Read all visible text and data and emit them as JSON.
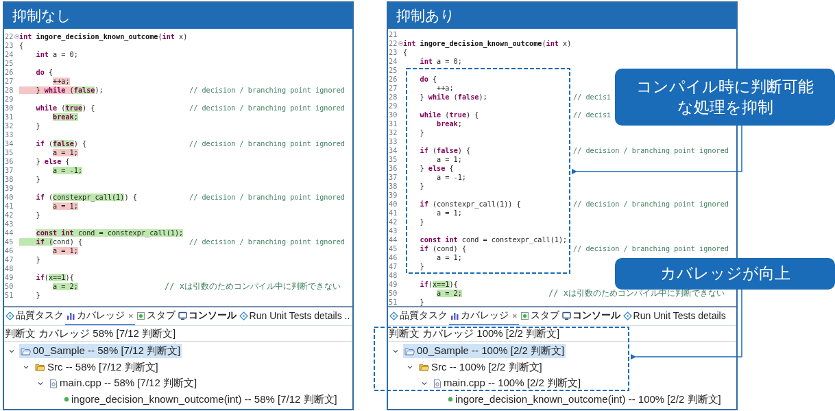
{
  "panels": [
    {
      "title": "抑制なし",
      "editor": {
        "lines": [
          {
            "number": "22",
            "fold": true,
            "code": [
              {
                "text": "int",
                "kind": "keyword"
              },
              {
                "text": " ingore_decision_known_outcome",
                "kind": "name"
              },
              {
                "text": "(",
                "kind": "plain"
              },
              {
                "text": "int",
                "kind": "keyword"
              },
              {
                "text": " x)",
                "kind": "plain"
              }
            ]
          },
          {
            "number": "23",
            "code": [
              {
                "text": "{",
                "kind": "plain"
              }
            ]
          },
          {
            "number": "24",
            "code": [
              {
                "text": "    int",
                "kind": "keyword"
              },
              {
                "text": " a = 0;",
                "kind": "plain"
              }
            ]
          },
          {
            "number": "25"
          },
          {
            "number": "26",
            "code": [
              {
                "text": "    do",
                "kind": "keyword"
              },
              {
                "text": " {",
                "kind": "plain"
              }
            ]
          },
          {
            "number": "27",
            "code": [
              {
                "text": "        ++a;",
                "kind": "plain",
                "color": "#f4c6c6",
                "indent_highlighted": false
              }
            ]
          },
          {
            "number": "28",
            "code": [
              {
                "text": "    } ",
                "kind": "plain",
                "color": "#f4c6c6",
                "indent_highlighted": true
              },
              {
                "text": "while",
                "kind": "keyword",
                "color": "#f4c6c6"
              },
              {
                "text": " (",
                "kind": "plain",
                "color": "#f4c6c6"
              },
              {
                "text": "false",
                "kind": "keyword",
                "color": "#bfe8b0"
              },
              {
                "text": ");",
                "kind": "plain"
              }
            ],
            "comment": "// decision / branching point ignored"
          },
          {
            "number": "29"
          },
          {
            "number": "30",
            "code": [
              {
                "text": "    while",
                "kind": "keyword"
              },
              {
                "text": " (",
                "kind": "plain"
              },
              {
                "text": "true",
                "kind": "keyword",
                "color": "#bfe8b0"
              },
              {
                "text": ") {",
                "kind": "plain"
              }
            ],
            "comment": "// decision / branching point ignored"
          },
          {
            "number": "31",
            "code": [
              {
                "text": "        break",
                "kind": "keyword",
                "color": "#bfe8b0",
                "indent_highlighted": false
              },
              {
                "text": ";",
                "kind": "plain",
                "color": "#bfe8b0"
              }
            ]
          },
          {
            "number": "32",
            "code": [
              {
                "text": "    }",
                "kind": "plain"
              }
            ]
          },
          {
            "number": "33"
          },
          {
            "number": "34",
            "code": [
              {
                "text": "    if",
                "kind": "keyword"
              },
              {
                "text": " (",
                "kind": "plain"
              },
              {
                "text": "false",
                "kind": "keyword",
                "color": "#bfe8b0"
              },
              {
                "text": ") {",
                "kind": "plain"
              }
            ],
            "comment": "// decision / branching point ignored"
          },
          {
            "number": "35",
            "code": [
              {
                "text": "        a = 1;",
                "kind": "plain",
                "color": "#f4c6c6",
                "indent_highlighted": false
              }
            ]
          },
          {
            "number": "36",
            "code": [
              {
                "text": "    } ",
                "kind": "plain"
              },
              {
                "text": "else",
                "kind": "keyword"
              },
              {
                "text": " {",
                "kind": "plain"
              }
            ]
          },
          {
            "number": "37",
            "code": [
              {
                "text": "        a = -1;",
                "kind": "plain",
                "color": "#bfe8b0",
                "indent_highlighted": false
              }
            ]
          },
          {
            "number": "38",
            "code": [
              {
                "text": "    }",
                "kind": "plain"
              }
            ]
          },
          {
            "number": "39"
          },
          {
            "number": "40",
            "code": [
              {
                "text": "    if",
                "kind": "keyword"
              },
              {
                "text": " (",
                "kind": "plain"
              },
              {
                "text": "constexpr_call(1)",
                "kind": "plain",
                "color": "#bfe8b0"
              },
              {
                "text": ") {",
                "kind": "plain"
              }
            ],
            "comment": "// decision / branching point ignored"
          },
          {
            "number": "41",
            "code": [
              {
                "text": "        a = 1;",
                "kind": "plain",
                "color": "#f4c6c6",
                "indent_highlighted": false
              }
            ]
          },
          {
            "number": "42",
            "code": [
              {
                "text": "    }",
                "kind": "plain"
              }
            ]
          },
          {
            "number": "43"
          },
          {
            "number": "44",
            "code": [
              {
                "text": "    const int",
                "kind": "keyword",
                "color": "#bfe8b0",
                "indent_highlighted": false
              },
              {
                "text": " cond = constexpr_call(1);",
                "kind": "plain",
                "color": "#bfe8b0"
              }
            ]
          },
          {
            "number": "45",
            "code": [
              {
                "text": "    if",
                "kind": "keyword",
                "color": "#bfe8b0",
                "indent_highlighted": true
              },
              {
                "text": " (",
                "kind": "plain",
                "color": "#bfe8b0"
              },
              {
                "text": "cond) {",
                "kind": "plain"
              }
            ],
            "comment": "// decision / branching point ignored"
          },
          {
            "number": "46",
            "code": [
              {
                "text": "        a = 1;",
                "kind": "plain",
                "color": "#f4c6c6",
                "indent_highlighted": false
              }
            ]
          },
          {
            "number": "47",
            "code": [
              {
                "text": "    }",
                "kind": "plain"
              }
            ]
          },
          {
            "number": "48"
          },
          {
            "number": "49",
            "code": [
              {
                "text": "    if",
                "kind": "keyword"
              },
              {
                "text": "(",
                "kind": "plain"
              },
              {
                "text": "x==1",
                "kind": "plain",
                "color": "#bfe8b0"
              },
              {
                "text": "){",
                "kind": "plain"
              }
            ]
          },
          {
            "number": "50",
            "code": [
              {
                "text": "        a = 2;",
                "kind": "plain",
                "color": "#bfe8b0",
                "indent_highlighted": false
              }
            ],
            "comment": "// xは引数のためコンパイル中に判断できない"
          },
          {
            "number": "51",
            "code": [
              {
                "text": "    }",
                "kind": "plain"
              }
            ]
          }
        ]
      },
      "coverage_view": {
        "tabs": [
          {
            "label": "品質タスク",
            "kind": "task",
            "selected": false,
            "emphasized": false
          },
          {
            "label": "カバレッジ",
            "kind": "coverage",
            "selected": true,
            "emphasized": false,
            "close": "×"
          },
          {
            "label": "スタブ",
            "kind": "stub",
            "selected": false,
            "emphasized": false
          },
          {
            "label": "コンソール",
            "kind": "console",
            "selected": false,
            "emphasized": true
          },
          {
            "label": "Run Unit Tests details ..",
            "kind": "task",
            "selected": false,
            "emphasized": false
          }
        ],
        "summary": "判断文 カバレッジ 58% [7/12 判断文]",
        "tree": [
          {
            "label": "00_Sample -- 58% [7/12 判断文]",
            "kind": "project",
            "selected": true,
            "expanded": true,
            "children": [
              {
                "label": "Src -- 58% [7/12 判断文]",
                "kind": "folder",
                "selected": false,
                "expanded": true,
                "children": [
                  {
                    "label": "main.cpp -- 58% [7/12 判断文]",
                    "kind": "file",
                    "selected": false,
                    "expanded": true,
                    "children": [
                      {
                        "label": "ingore_decision_known_outcome(int) -- 58% [7/12 判断文]",
                        "kind": "function",
                        "selected": false
                      }
                    ]
                  }
                ]
              }
            ]
          }
        ]
      }
    },
    {
      "title": "抑制あり",
      "editor": {
        "lines": [
          {
            "number": "21"
          },
          {
            "number": "22",
            "fold": true,
            "code": [
              {
                "text": "int",
                "kind": "keyword"
              },
              {
                "text": " ingore_decision_known_outcome",
                "kind": "name"
              },
              {
                "text": "(",
                "kind": "plain"
              },
              {
                "text": "int",
                "kind": "keyword"
              },
              {
                "text": " x)",
                "kind": "plain"
              }
            ]
          },
          {
            "number": "23",
            "code": [
              {
                "text": "{",
                "kind": "plain"
              }
            ]
          },
          {
            "number": "24",
            "code": [
              {
                "text": "    int",
                "kind": "keyword"
              },
              {
                "text": " a = 0;",
                "kind": "plain"
              }
            ]
          },
          {
            "number": "25"
          },
          {
            "number": "26",
            "code": [
              {
                "text": "    do",
                "kind": "keyword"
              },
              {
                "text": " {",
                "kind": "plain"
              }
            ]
          },
          {
            "number": "27",
            "code": [
              {
                "text": "        ++a;",
                "kind": "plain"
              }
            ]
          },
          {
            "number": "28",
            "code": [
              {
                "text": "    } ",
                "kind": "plain"
              },
              {
                "text": "while",
                "kind": "keyword"
              },
              {
                "text": " (",
                "kind": "plain"
              },
              {
                "text": "false",
                "kind": "keyword"
              },
              {
                "text": ");",
                "kind": "plain"
              }
            ],
            "comment": "// decisi"
          },
          {
            "number": "29"
          },
          {
            "number": "30",
            "code": [
              {
                "text": "    while",
                "kind": "keyword"
              },
              {
                "text": " (",
                "kind": "plain"
              },
              {
                "text": "true",
                "kind": "keyword"
              },
              {
                "text": ") {",
                "kind": "plain"
              }
            ],
            "comment": "// decisi"
          },
          {
            "number": "31",
            "code": [
              {
                "text": "        break",
                "kind": "keyword"
              },
              {
                "text": ";",
                "kind": "plain"
              }
            ]
          },
          {
            "number": "32",
            "code": [
              {
                "text": "    }",
                "kind": "plain"
              }
            ]
          },
          {
            "number": "33"
          },
          {
            "number": "34",
            "code": [
              {
                "text": "    if",
                "kind": "keyword"
              },
              {
                "text": " (",
                "kind": "plain"
              },
              {
                "text": "false",
                "kind": "keyword"
              },
              {
                "text": ") {",
                "kind": "plain"
              }
            ],
            "comment": "// decision / branching point ignored"
          },
          {
            "number": "35",
            "code": [
              {
                "text": "        a = 1;",
                "kind": "plain"
              }
            ]
          },
          {
            "number": "36",
            "code": [
              {
                "text": "    } ",
                "kind": "plain"
              },
              {
                "text": "else",
                "kind": "keyword"
              },
              {
                "text": " {",
                "kind": "plain"
              }
            ]
          },
          {
            "number": "37",
            "code": [
              {
                "text": "        a = -1;",
                "kind": "plain"
              }
            ]
          },
          {
            "number": "38",
            "code": [
              {
                "text": "    }",
                "kind": "plain"
              }
            ]
          },
          {
            "number": "39"
          },
          {
            "number": "40",
            "code": [
              {
                "text": "    if",
                "kind": "keyword"
              },
              {
                "text": " (constexpr_call(1)) {",
                "kind": "plain"
              }
            ],
            "comment": "// decision / branching point ignored"
          },
          {
            "number": "41",
            "code": [
              {
                "text": "        a = 1;",
                "kind": "plain"
              }
            ]
          },
          {
            "number": "42",
            "code": [
              {
                "text": "    }",
                "kind": "plain"
              }
            ]
          },
          {
            "number": "43"
          },
          {
            "number": "44",
            "code": [
              {
                "text": "    const int",
                "kind": "keyword"
              },
              {
                "text": " cond = constexpr_call(1);",
                "kind": "plain"
              }
            ]
          },
          {
            "number": "45",
            "code": [
              {
                "text": "    if",
                "kind": "keyword"
              },
              {
                "text": " (cond) {",
                "kind": "plain"
              }
            ],
            "comment": "// decision / branching point ignored"
          },
          {
            "number": "46",
            "code": [
              {
                "text": "        a = 1;",
                "kind": "plain"
              }
            ]
          },
          {
            "number": "47",
            "code": [
              {
                "text": "    }",
                "kind": "plain"
              }
            ]
          },
          {
            "number": "48"
          },
          {
            "number": "49",
            "code": [
              {
                "text": "    if",
                "kind": "keyword"
              },
              {
                "text": "(",
                "kind": "plain"
              },
              {
                "text": "x==1",
                "kind": "plain",
                "color": "#bfe8b0"
              },
              {
                "text": "){",
                "kind": "plain"
              }
            ]
          },
          {
            "number": "50",
            "code": [
              {
                "text": "        a = 2;",
                "kind": "plain",
                "color": "#bfe8b0",
                "indent_highlighted": false
              }
            ],
            "comment": "// xは引数のためコンパイル中に判断できない"
          },
          {
            "number": "51",
            "code": [
              {
                "text": "    }",
                "kind": "plain"
              }
            ]
          }
        ]
      },
      "coverage_view": {
        "tabs": [
          {
            "label": "品質タスク",
            "kind": "task",
            "selected": false,
            "emphasized": false
          },
          {
            "label": "カバレッジ",
            "kind": "coverage",
            "selected": true,
            "emphasized": false,
            "close": "×"
          },
          {
            "label": "スタブ",
            "kind": "stub",
            "selected": false,
            "emphasized": false
          },
          {
            "label": "コンソール",
            "kind": "console",
            "selected": false,
            "emphasized": true
          },
          {
            "label": "Run Unit Tests details",
            "kind": "task",
            "selected": false,
            "emphasized": false
          }
        ],
        "summary": "判断文 カバレッジ 100% [2/2 判断文]",
        "tree": [
          {
            "label": "00_Sample -- 100% [2/2 判断文]",
            "kind": "project",
            "selected": true,
            "expanded": true,
            "children": [
              {
                "label": "Src -- 100% [2/2 判断文]",
                "kind": "folder",
                "selected": false,
                "expanded": true,
                "children": [
                  {
                    "label": "main.cpp -- 100% [2/2 判断文]",
                    "kind": "file",
                    "selected": false,
                    "expanded": true,
                    "children": [
                      {
                        "label": "ingore_decision_known_outcome(int) -- 100% [2/2 判断文]",
                        "kind": "function",
                        "selected": false
                      }
                    ]
                  }
                ]
              }
            ]
          }
        ]
      }
    }
  ],
  "callouts": [
    {
      "text": "コンパイル時に判断可能な処理を抑制"
    },
    {
      "text": "カバレッジが向上"
    }
  ]
}
